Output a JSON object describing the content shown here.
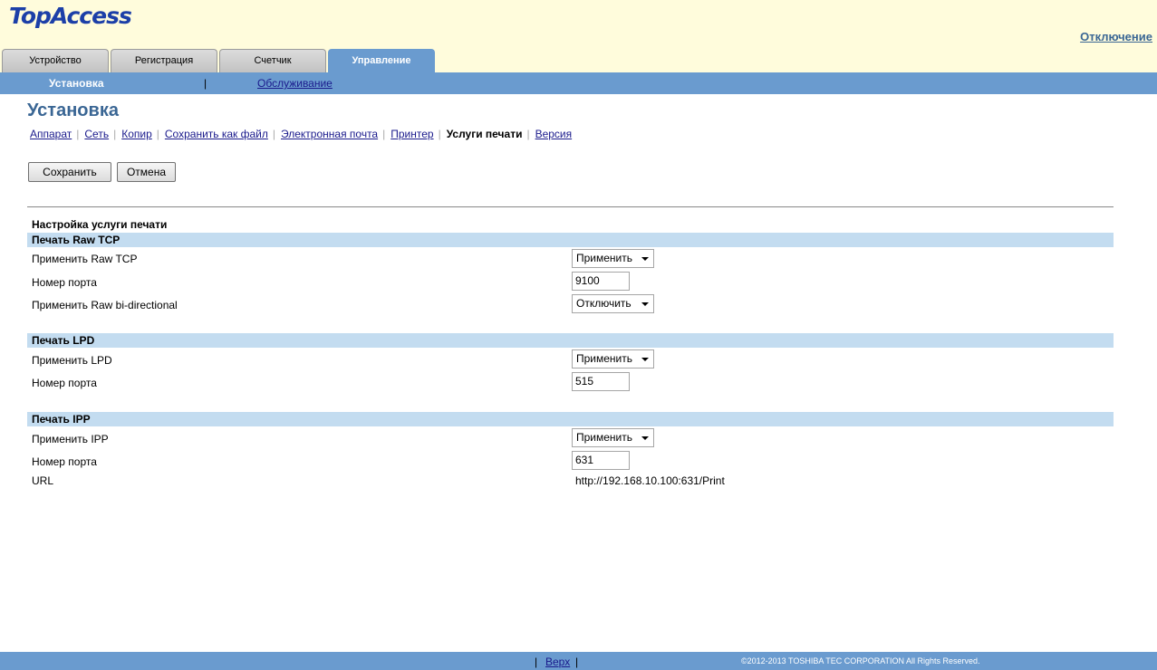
{
  "app": {
    "logo": "TopAccess",
    "logout": "Отключение"
  },
  "tabs": [
    {
      "label": "Устройство"
    },
    {
      "label": "Регистрация"
    },
    {
      "label": "Счетчик"
    },
    {
      "label": "Управление",
      "active": true
    }
  ],
  "subnav": {
    "active": "Установка",
    "separator": "|",
    "link": "Обслуживание"
  },
  "page": {
    "title": "Установка"
  },
  "menu": {
    "items": [
      "Аппарат",
      "Сеть",
      "Копир",
      "Сохранить как файл",
      "Электронная почта",
      "Принтер",
      "Услуги печати",
      "Версия"
    ],
    "current": "Услуги печати"
  },
  "buttons": {
    "save": "Сохранить",
    "cancel": "Отмена"
  },
  "settings": {
    "heading": "Настройка услуги печати",
    "raw": {
      "title": "Печать Raw TCP",
      "enable_label": "Применить Raw TCP",
      "enable_value": "Применить",
      "port_label": "Номер порта",
      "port_value": "9100",
      "bidi_label": "Применить Raw bi-directional",
      "bidi_value": "Отключить"
    },
    "lpd": {
      "title": "Печать LPD",
      "enable_label": "Применить LPD",
      "enable_value": "Применить",
      "port_label": "Номер порта",
      "port_value": "515"
    },
    "ipp": {
      "title": "Печать IPP",
      "enable_label": "Применить IPP",
      "enable_value": "Применить",
      "port_label": "Номер порта",
      "port_value": "631",
      "url_label": "URL",
      "url_value": "http://192.168.10.100:631/Print"
    }
  },
  "footer": {
    "sep": "|",
    "top_link": "Верх",
    "copyright": "©2012-2013 TOSHIBA TEC CORPORATION All Rights Reserved."
  },
  "colors": {
    "accent": "#6a9bcf",
    "header_bg": "#fffcdc",
    "section_bg": "#c3dcf0",
    "title": "#3a6694"
  }
}
